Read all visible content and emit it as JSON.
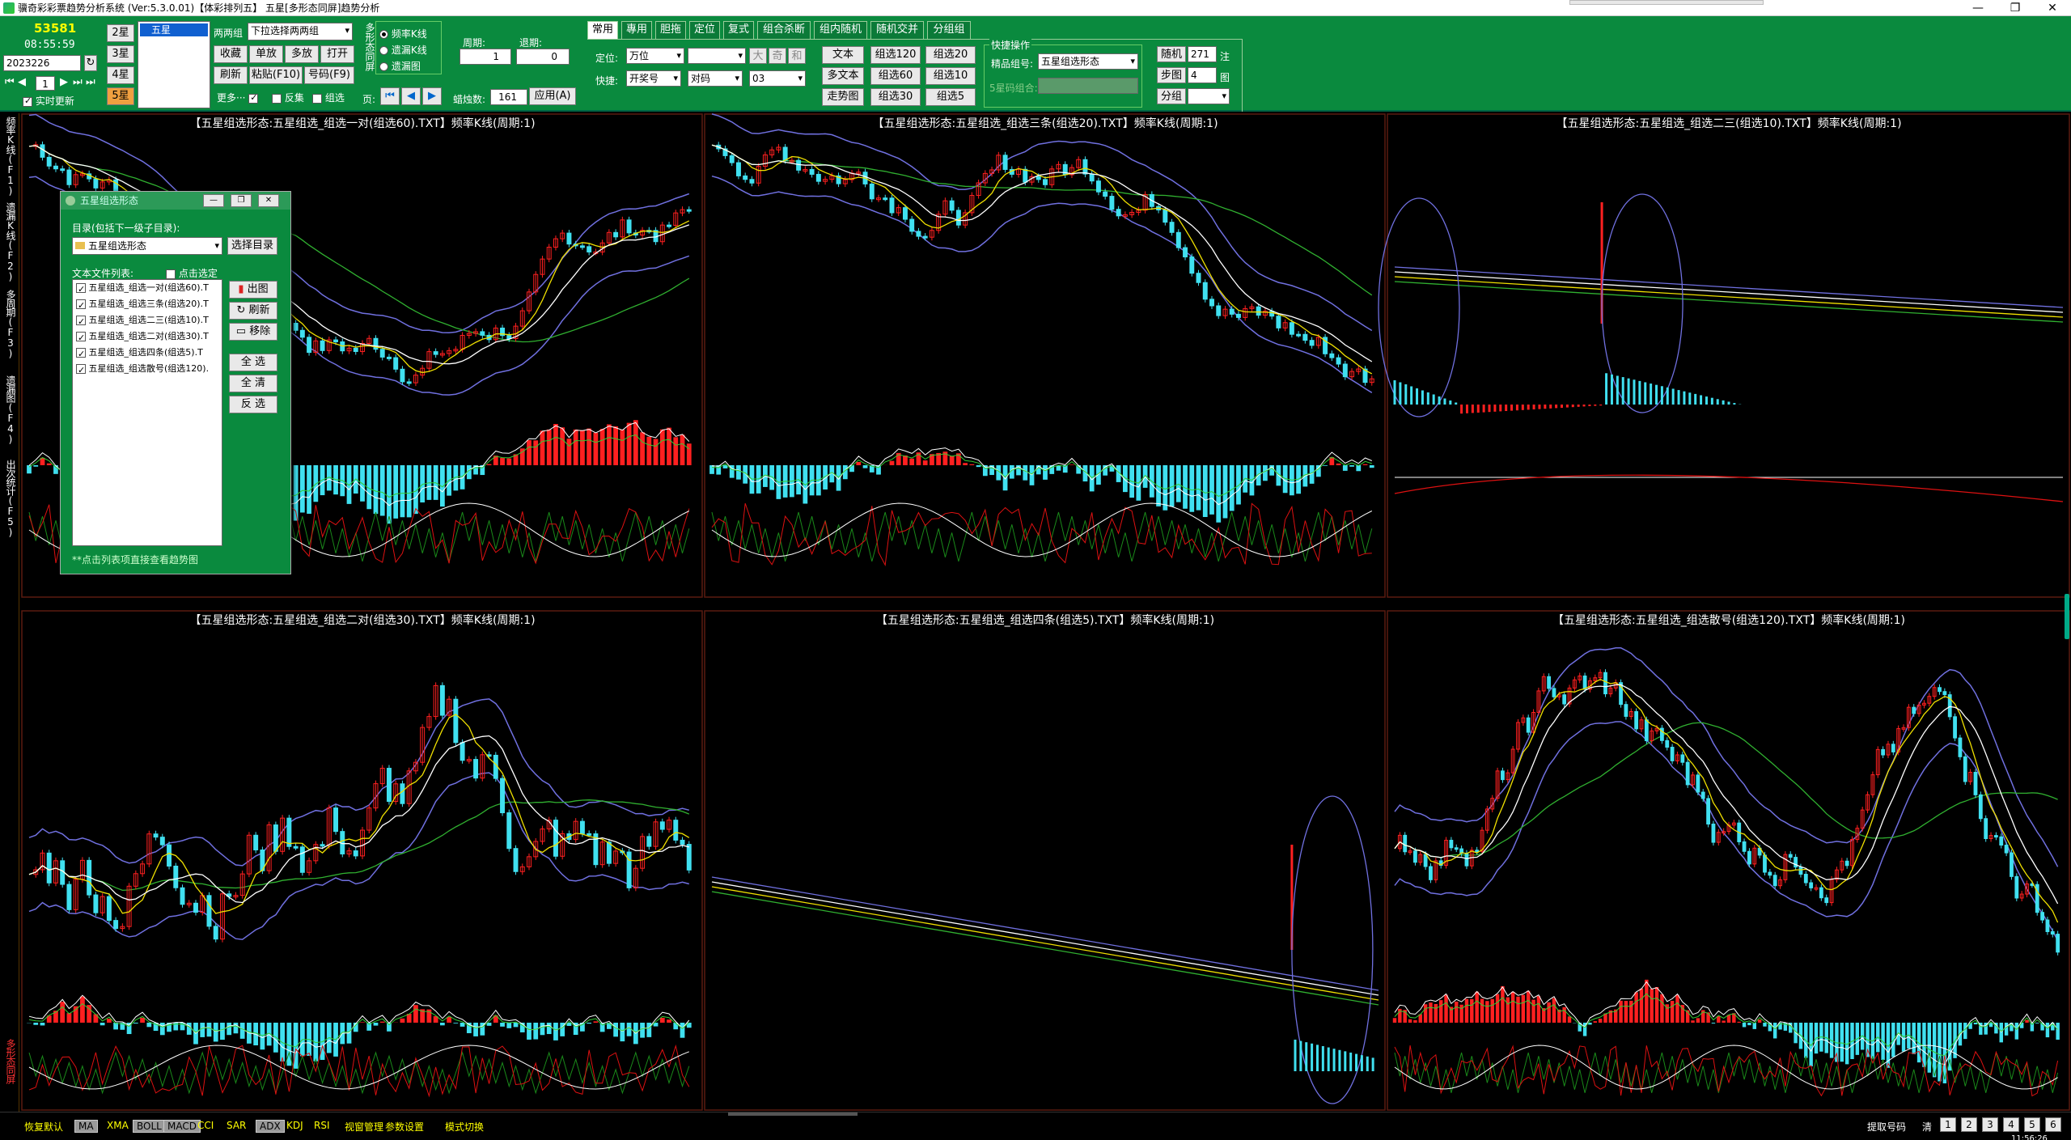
{
  "window": {
    "title": "骥奇彩彩票趋势分析系统 (Ver:5.3.0.01)【体彩排列五】 五星[多形态同屏]趋势分析",
    "minimize": "—",
    "maximize": "❐",
    "close": "✕"
  },
  "left_panel": {
    "counter": "53581",
    "clock": "08:55:59",
    "date": "2023226",
    "spin_value": "1",
    "realtime_label": "实时更新",
    "star_buttons": [
      "2星",
      "3星",
      "4星",
      "5星"
    ],
    "list_item": "五星"
  },
  "toolbar1": {
    "pair_group_label": "两两组",
    "pair_group_select": "下拉选择两两组",
    "buttons_row1": [
      "收藏",
      "单放",
      "多放",
      "打开"
    ],
    "buttons_row2": [
      "刷新",
      "粘贴(F10)",
      "号码(F9)"
    ],
    "more_label": "更多···",
    "check_fanji": "反集",
    "check_zuxuan": "组选",
    "multi_label": "多形态同屏",
    "radio_options": [
      "频率K线",
      "遗漏K线",
      "遗漏图"
    ],
    "period_label": "周期:",
    "period_value": "1",
    "back_label": "退期:",
    "back_value": "0",
    "page_label": "页:",
    "candle_label": "蜡烛数:",
    "candle_value": "161",
    "apply_btn": "应用(A)"
  },
  "tabs": [
    "常用",
    "專用",
    "胆拖",
    "定位",
    "复式",
    "组合杀断",
    "组内随机",
    "随机交并",
    "分组组"
  ],
  "toolbar2": {
    "locate_label": "定位:",
    "locate_value": "万位",
    "btn_big": "大",
    "btn_odd": "奇",
    "btn_sum": "和",
    "quick_label": "快捷:",
    "quick_value1": "开奖号",
    "quick_value2": "对码",
    "quick_value3": "03",
    "btn_text": "文本",
    "btn_multi_text": "多文本",
    "btn_trend": "走势图",
    "grp_buttons": [
      "组选120",
      "组选20",
      "组选60",
      "组选10",
      "组选30",
      "组选5"
    ],
    "quick_ops_title": "快捷操作",
    "fine_group_label": "精品组号:",
    "fine_group_value": "五星组选形态",
    "five_star_label": "5星码组合:",
    "random_label": "随机",
    "random_value": "271",
    "random_unit": "注",
    "step_label": "步图",
    "step_value": "4",
    "step_unit": "图",
    "split_label": "分组"
  },
  "left_vtabs": [
    "频率K线(F1)",
    "遗漏K线(F2)",
    "多周期(F3)",
    "遗漏图(F4)",
    "出次统计(F5)",
    "多形态同屏(F6)"
  ],
  "panels": [
    {
      "title": "【五星组选形态:五星组选_组选一对(组选60).TXT】频率K线(周期:1)"
    },
    {
      "title": "【五星组选形态:五星组选_组选三条(组选20).TXT】频率K线(周期:1)"
    },
    {
      "title": "【五星组选形态:五星组选_组选二三(组选10).TXT】频率K线(周期:1)"
    },
    {
      "title": "【五星组选形态:五星组选_组选二对(组选30).TXT】频率K线(周期:1)"
    },
    {
      "title": "【五星组选形态:五星组选_组选四条(组选5).TXT】频率K线(周期:1)"
    },
    {
      "title": "【五星组选形态:五星组选_组选散号(组选120).TXT】频率K线(周期:1)"
    }
  ],
  "dialog": {
    "title": "五星组选形态",
    "dir_label": "目录(包括下一级子目录):",
    "dir_value": "五星组选形态",
    "choose_dir_btn": "选择目录",
    "file_list_label": "文本文件列表:",
    "click_select_label": "点击选定",
    "files": [
      "五星组选_组选一对(组选60).T",
      "五星组选_组选三条(组选20).T",
      "五星组选_组选二三(组选10).T",
      "五星组选_组选二对(组选30).T",
      "五星组选_组选四条(组选5).T",
      "五星组选_组选散号(组选120)."
    ],
    "btn_chart": "出图",
    "btn_refresh": "刷新",
    "btn_remove": "移除",
    "btn_all": "全 选",
    "btn_clear": "全 清",
    "btn_invert": "反 选",
    "hint": "**点击列表项直接查看趋势图"
  },
  "bottombar": {
    "items": [
      "恢复默认",
      "MA",
      "XMA",
      "BOLL",
      "MACD",
      "CCI",
      "SAR",
      "ADX",
      "KDJ",
      "RSI",
      "视窗管理",
      "参数设置",
      "模式切换"
    ],
    "boxed": [
      1,
      3,
      4,
      7
    ],
    "fetch_label": "提取号码",
    "clear_label": "清",
    "pages": [
      "1",
      "2",
      "3",
      "4",
      "5",
      "6"
    ],
    "clock_partial": "11:56:26"
  },
  "colors": {
    "toolbar_bg": "#0a8a3e",
    "up_candle": "#ff2020",
    "down_candle": "#40e0f0",
    "ma_yellow": "#f0e000",
    "ma_white": "#ffffff",
    "boll_band": "#7070e0",
    "ma_green": "#30b030"
  }
}
